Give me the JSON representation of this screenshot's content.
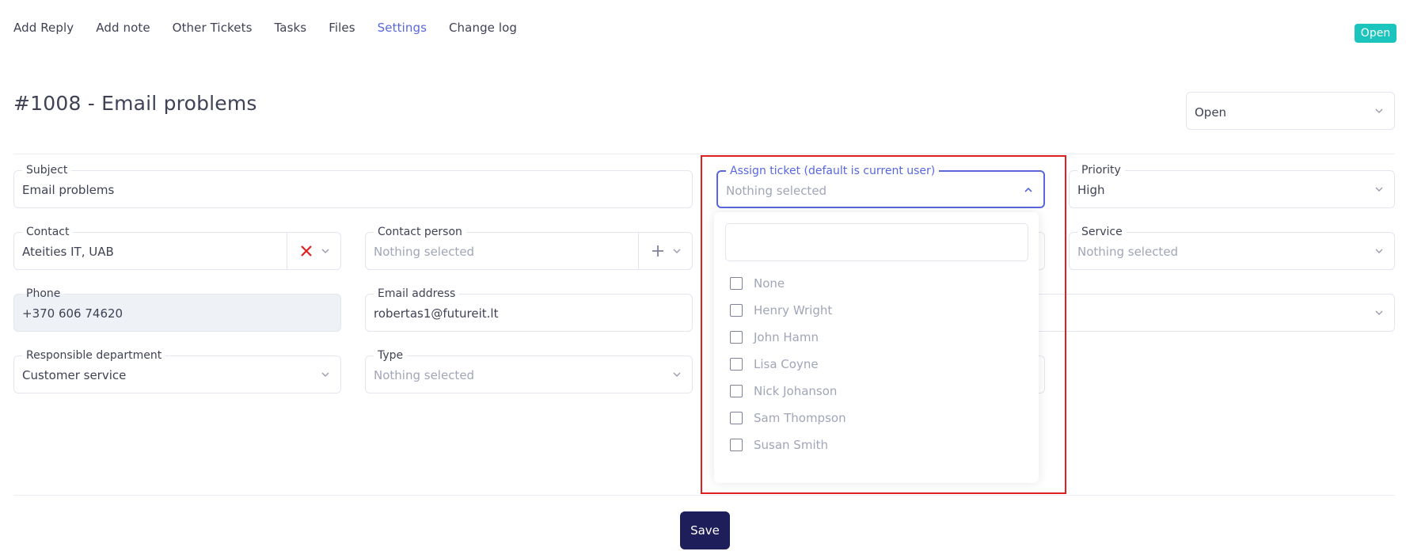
{
  "nav": {
    "items": [
      "Add Reply",
      "Add note",
      "Other Tickets",
      "Tasks",
      "Files",
      "Settings",
      "Change log"
    ],
    "active": "Settings"
  },
  "status_badge": "Open",
  "ticket": {
    "title": "#1008 - Email problems",
    "status_select": "Open"
  },
  "fields": {
    "subject": {
      "label": "Subject",
      "value": "Email problems"
    },
    "assign": {
      "label": "Assign ticket (default is current user)",
      "placeholder": "Nothing selected"
    },
    "priority": {
      "label": "Priority",
      "value": "High"
    },
    "contact": {
      "label": "Contact",
      "value": "Ateities IT, UAB"
    },
    "contact_person": {
      "label": "Contact person",
      "placeholder": "Nothing selected"
    },
    "service": {
      "label": "Service",
      "placeholder": "Nothing selected"
    },
    "phone": {
      "label": "Phone",
      "value": "+370 606 74620"
    },
    "email": {
      "label": "Email address",
      "value": "robertas1@futureit.lt"
    },
    "department": {
      "label": "Responsible department",
      "value": "Customer service"
    },
    "type": {
      "label": "Type",
      "placeholder": "Nothing selected"
    }
  },
  "assign_dropdown": {
    "search_value": "",
    "options": [
      "None",
      "Henry Wright",
      "John Hamn",
      "Lisa Coyne",
      "Nick Johanson",
      "Sam Thompson",
      "Susan Smith"
    ]
  },
  "buttons": {
    "save": "Save"
  },
  "colors": {
    "accent": "#5867dd",
    "badge": "#1bc5bd",
    "save_bg": "#1e1e5a",
    "clear_x": "#e02020",
    "highlight": "#e02020"
  }
}
